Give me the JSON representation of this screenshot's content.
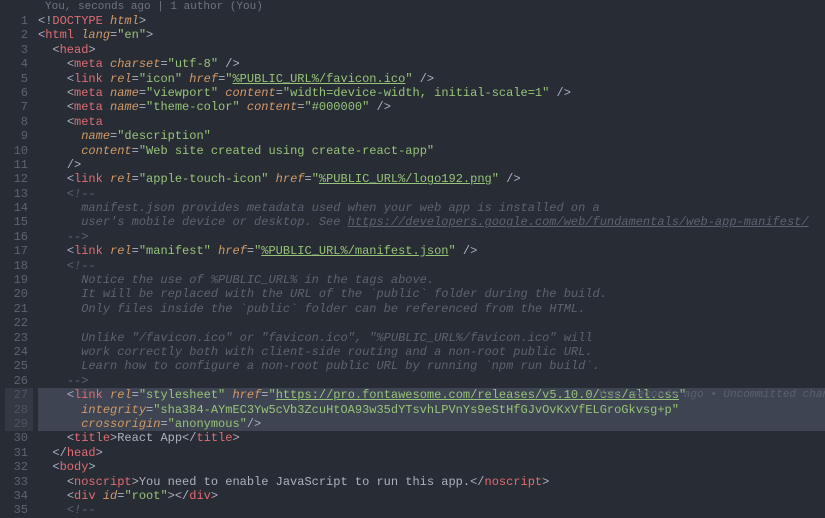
{
  "codelens": "You, seconds ago | 1 author (You)",
  "blame": "You, seconds ago • Uncommitted changes",
  "line_start": 1,
  "line_end": 35,
  "highlighted_lines": [
    27,
    28,
    29
  ],
  "tokens": [
    [
      [
        "t-pun",
        "<!"
      ],
      [
        "t-tag",
        "DOCTYPE "
      ],
      [
        "t-attr",
        "html"
      ],
      [
        "t-pun",
        ">"
      ]
    ],
    [
      [
        "t-pun",
        "<"
      ],
      [
        "t-tag",
        "html "
      ],
      [
        "t-attr",
        "lang"
      ],
      [
        "t-pun",
        "="
      ],
      [
        "t-str",
        "\"en\""
      ],
      [
        "t-pun",
        ">"
      ]
    ],
    [
      [
        "t-ind",
        "  "
      ],
      [
        "t-pun",
        "<"
      ],
      [
        "t-tag",
        "head"
      ],
      [
        "t-pun",
        ">"
      ]
    ],
    [
      [
        "t-ind",
        "    "
      ],
      [
        "t-pun",
        "<"
      ],
      [
        "t-tag",
        "meta "
      ],
      [
        "t-attr",
        "charset"
      ],
      [
        "t-pun",
        "="
      ],
      [
        "t-str",
        "\"utf-8\""
      ],
      [
        "t-pun",
        " />"
      ]
    ],
    [
      [
        "t-ind",
        "    "
      ],
      [
        "t-pun",
        "<"
      ],
      [
        "t-tag",
        "link "
      ],
      [
        "t-attr",
        "rel"
      ],
      [
        "t-pun",
        "="
      ],
      [
        "t-str",
        "\"icon\" "
      ],
      [
        "t-attr",
        "href"
      ],
      [
        "t-pun",
        "="
      ],
      [
        "t-str",
        "\""
      ],
      [
        "t-url",
        "%PUBLIC_URL%/favicon.ico"
      ],
      [
        "t-str",
        "\" "
      ],
      [
        "t-pun",
        "/>"
      ]
    ],
    [
      [
        "t-ind",
        "    "
      ],
      [
        "t-pun",
        "<"
      ],
      [
        "t-tag",
        "meta "
      ],
      [
        "t-attr",
        "name"
      ],
      [
        "t-pun",
        "="
      ],
      [
        "t-str",
        "\"viewport\" "
      ],
      [
        "t-attr",
        "content"
      ],
      [
        "t-pun",
        "="
      ],
      [
        "t-str",
        "\"width=device-width, initial-scale=1\""
      ],
      [
        "t-pun",
        " />"
      ]
    ],
    [
      [
        "t-ind",
        "    "
      ],
      [
        "t-pun",
        "<"
      ],
      [
        "t-tag",
        "meta "
      ],
      [
        "t-attr",
        "name"
      ],
      [
        "t-pun",
        "="
      ],
      [
        "t-str",
        "\"theme-color\" "
      ],
      [
        "t-attr",
        "content"
      ],
      [
        "t-pun",
        "="
      ],
      [
        "t-str",
        "\"#000000\""
      ],
      [
        "t-pun",
        " />"
      ]
    ],
    [
      [
        "t-ind",
        "    "
      ],
      [
        "t-pun",
        "<"
      ],
      [
        "t-tag",
        "meta"
      ]
    ],
    [
      [
        "t-ind",
        "      "
      ],
      [
        "t-attr",
        "name"
      ],
      [
        "t-pun",
        "="
      ],
      [
        "t-str",
        "\"description\""
      ]
    ],
    [
      [
        "t-ind",
        "      "
      ],
      [
        "t-attr",
        "content"
      ],
      [
        "t-pun",
        "="
      ],
      [
        "t-str",
        "\"Web site created using create-react-app\""
      ]
    ],
    [
      [
        "t-ind",
        "    "
      ],
      [
        "t-pun",
        "/>"
      ]
    ],
    [
      [
        "t-ind",
        "    "
      ],
      [
        "t-pun",
        "<"
      ],
      [
        "t-tag",
        "link "
      ],
      [
        "t-attr",
        "rel"
      ],
      [
        "t-pun",
        "="
      ],
      [
        "t-str",
        "\"apple-touch-icon\" "
      ],
      [
        "t-attr",
        "href"
      ],
      [
        "t-pun",
        "="
      ],
      [
        "t-str",
        "\""
      ],
      [
        "t-url",
        "%PUBLIC_URL%/logo192.png"
      ],
      [
        "t-str",
        "\" "
      ],
      [
        "t-pun",
        "/>"
      ]
    ],
    [
      [
        "t-ind",
        "    "
      ],
      [
        "t-cmt",
        "<!--"
      ]
    ],
    [
      [
        "t-ind",
        "      "
      ],
      [
        "t-cmt",
        "manifest.json provides metadata used when your web app is installed on a"
      ]
    ],
    [
      [
        "t-ind",
        "      "
      ],
      [
        "t-cmt",
        "user's mobile device or desktop. See "
      ],
      [
        "t-cmturl",
        "https://developers.google.com/web/fundamentals/web-app-manifest/"
      ]
    ],
    [
      [
        "t-ind",
        "    "
      ],
      [
        "t-cmt",
        "-->"
      ]
    ],
    [
      [
        "t-ind",
        "    "
      ],
      [
        "t-pun",
        "<"
      ],
      [
        "t-tag",
        "link "
      ],
      [
        "t-attr",
        "rel"
      ],
      [
        "t-pun",
        "="
      ],
      [
        "t-str",
        "\"manifest\" "
      ],
      [
        "t-attr",
        "href"
      ],
      [
        "t-pun",
        "="
      ],
      [
        "t-str",
        "\""
      ],
      [
        "t-url",
        "%PUBLIC_URL%/manifest.json"
      ],
      [
        "t-str",
        "\" "
      ],
      [
        "t-pun",
        "/>"
      ]
    ],
    [
      [
        "t-ind",
        "    "
      ],
      [
        "t-cmt",
        "<!--"
      ]
    ],
    [
      [
        "t-ind",
        "      "
      ],
      [
        "t-cmt",
        "Notice the use of %PUBLIC_URL% in the tags above."
      ]
    ],
    [
      [
        "t-ind",
        "      "
      ],
      [
        "t-cmt",
        "It will be replaced with the URL of the `public` folder during the build."
      ]
    ],
    [
      [
        "t-ind",
        "      "
      ],
      [
        "t-cmt",
        "Only files inside the `public` folder can be referenced from the HTML."
      ]
    ],
    [
      [
        "t-cmt",
        ""
      ]
    ],
    [
      [
        "t-ind",
        "      "
      ],
      [
        "t-cmt",
        "Unlike \"/favicon.ico\" or \"favicon.ico\", \"%PUBLIC_URL%/favicon.ico\" will"
      ]
    ],
    [
      [
        "t-ind",
        "      "
      ],
      [
        "t-cmt",
        "work correctly both with client-side routing and a non-root public URL."
      ]
    ],
    [
      [
        "t-ind",
        "      "
      ],
      [
        "t-cmt",
        "Learn how to configure a non-root public URL by running `npm run build`."
      ]
    ],
    [
      [
        "t-ind",
        "    "
      ],
      [
        "t-cmt",
        "-->"
      ]
    ],
    [
      [
        "t-ind",
        "    "
      ],
      [
        "t-pun",
        "<"
      ],
      [
        "t-tag",
        "link "
      ],
      [
        "t-attr",
        "rel"
      ],
      [
        "t-pun",
        "="
      ],
      [
        "t-str",
        "\"stylesheet\" "
      ],
      [
        "t-attr",
        "href"
      ],
      [
        "t-pun",
        "="
      ],
      [
        "t-str",
        "\""
      ],
      [
        "t-url",
        "https://pro.fontawesome.com/releases/v5.10.0/css/all.css"
      ],
      [
        "t-str",
        "\""
      ]
    ],
    [
      [
        "t-ind",
        "      "
      ],
      [
        "t-attr",
        "integrity"
      ],
      [
        "t-pun",
        "="
      ],
      [
        "t-str",
        "\"sha384-AYmEC3Yw5cVb3ZcuHtOA93w35dYTsvhLPVnYs9eStHfGJvOvKxVfELGroGkvsg+p\""
      ]
    ],
    [
      [
        "t-ind",
        "      "
      ],
      [
        "t-attr",
        "crossorigin"
      ],
      [
        "t-pun",
        "="
      ],
      [
        "t-str",
        "\"anonymous\""
      ],
      [
        "t-pun",
        "/>"
      ]
    ],
    [
      [
        "t-ind",
        "    "
      ],
      [
        "t-pun",
        "<"
      ],
      [
        "t-tag",
        "title"
      ],
      [
        "t-pun",
        ">"
      ],
      [
        "t-txt",
        "React App"
      ],
      [
        "t-pun",
        "</"
      ],
      [
        "t-tag",
        "title"
      ],
      [
        "t-pun",
        ">"
      ]
    ],
    [
      [
        "t-ind",
        "  "
      ],
      [
        "t-pun",
        "</"
      ],
      [
        "t-tag",
        "head"
      ],
      [
        "t-pun",
        ">"
      ]
    ],
    [
      [
        "t-ind",
        "  "
      ],
      [
        "t-pun",
        "<"
      ],
      [
        "t-tag",
        "body"
      ],
      [
        "t-pun",
        ">"
      ]
    ],
    [
      [
        "t-ind",
        "    "
      ],
      [
        "t-pun",
        "<"
      ],
      [
        "t-tag",
        "noscript"
      ],
      [
        "t-pun",
        ">"
      ],
      [
        "t-txt",
        "You need to enable JavaScript to run this app."
      ],
      [
        "t-pun",
        "</"
      ],
      [
        "t-tag",
        "noscript"
      ],
      [
        "t-pun",
        ">"
      ]
    ],
    [
      [
        "t-ind",
        "    "
      ],
      [
        "t-pun",
        "<"
      ],
      [
        "t-tag",
        "div "
      ],
      [
        "t-attr",
        "id"
      ],
      [
        "t-pun",
        "="
      ],
      [
        "t-str",
        "\"root\""
      ],
      [
        "t-pun",
        "></"
      ],
      [
        "t-tag",
        "div"
      ],
      [
        "t-pun",
        ">"
      ]
    ],
    [
      [
        "t-ind",
        "    "
      ],
      [
        "t-cmt",
        "<!--"
      ]
    ]
  ]
}
